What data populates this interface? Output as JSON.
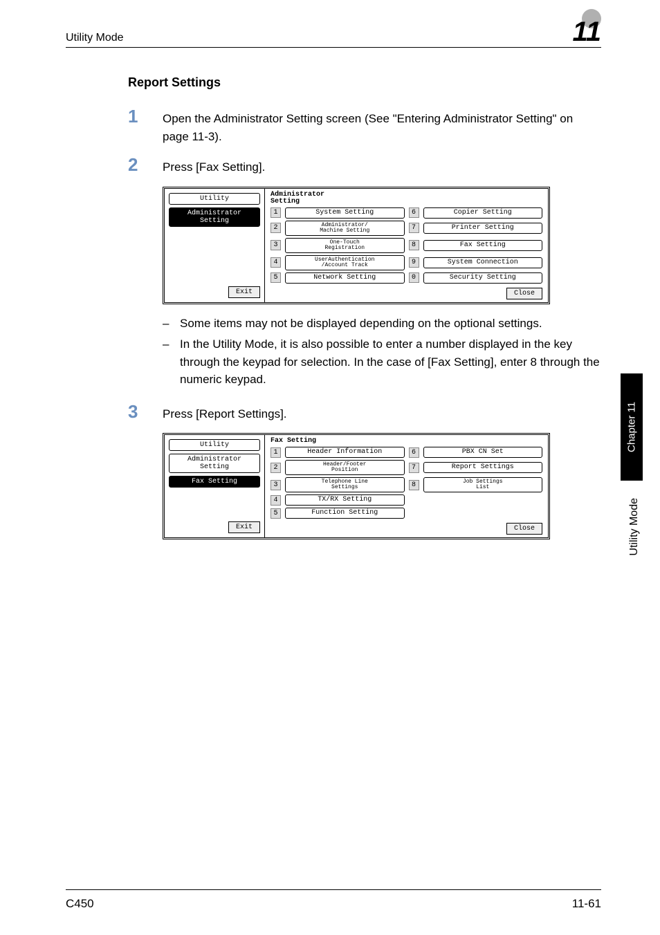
{
  "header": {
    "left": "Utility Mode",
    "right": "11"
  },
  "subtitle": "Report Settings",
  "steps": {
    "s1": {
      "num": "1",
      "text": "Open the Administrator Setting screen (See \"Entering Administrator Setting\" on page 11-3)."
    },
    "s2": {
      "num": "2",
      "text": "Press [Fax Setting]."
    },
    "s3": {
      "num": "3",
      "text": "Press [Report Settings]."
    }
  },
  "screen1": {
    "leftTabs": {
      "utility": "Utility",
      "admin": "Administrator\nSetting"
    },
    "title": "Administrator\nSetting",
    "items": {
      "i1": "System Setting",
      "i2": "Administrator/\nMachine Setting",
      "i3": "One-Touch\nRegistration",
      "i4": "UserAuthentication\n/Account Track",
      "i5": "Network Setting",
      "i6": "Copier Setting",
      "i7": "Printer Setting",
      "i8": "Fax Setting",
      "i9": "System Connection",
      "i0": "Security Setting"
    },
    "nums": {
      "n1": "1",
      "n2": "2",
      "n3": "3",
      "n4": "4",
      "n5": "5",
      "n6": "6",
      "n7": "7",
      "n8": "8",
      "n9": "9",
      "n0": "0"
    },
    "exit": "Exit",
    "close": "Close"
  },
  "notes": {
    "n1": "Some items may not be displayed depending on the optional settings.",
    "n2": "In the Utility Mode, it is also possible to enter a number displayed in the key through the keypad for selection. In the case of [Fax Setting], enter 8 through the numeric keypad."
  },
  "screen2": {
    "leftTabs": {
      "utility": "Utility",
      "admin": "Administrator\nSetting",
      "fax": "Fax Setting"
    },
    "title": "Fax Setting",
    "items": {
      "i1": "Header Information",
      "i2": "Header/Footer\nPosition",
      "i3": "Telephone Line\nSettings",
      "i4": "TX/RX Setting",
      "i5": "Function Setting",
      "i6": "PBX CN Set",
      "i7": "Report Settings",
      "i8": "Job Settings\nList"
    },
    "nums": {
      "n1": "1",
      "n2": "2",
      "n3": "3",
      "n4": "4",
      "n5": "5",
      "n6": "6",
      "n7": "7",
      "n8": "8"
    },
    "exit": "Exit",
    "close": "Close"
  },
  "sideTab": "Chapter 11",
  "sideLabel": "Utility Mode",
  "footer": {
    "left": "C450",
    "right": "11-61"
  }
}
